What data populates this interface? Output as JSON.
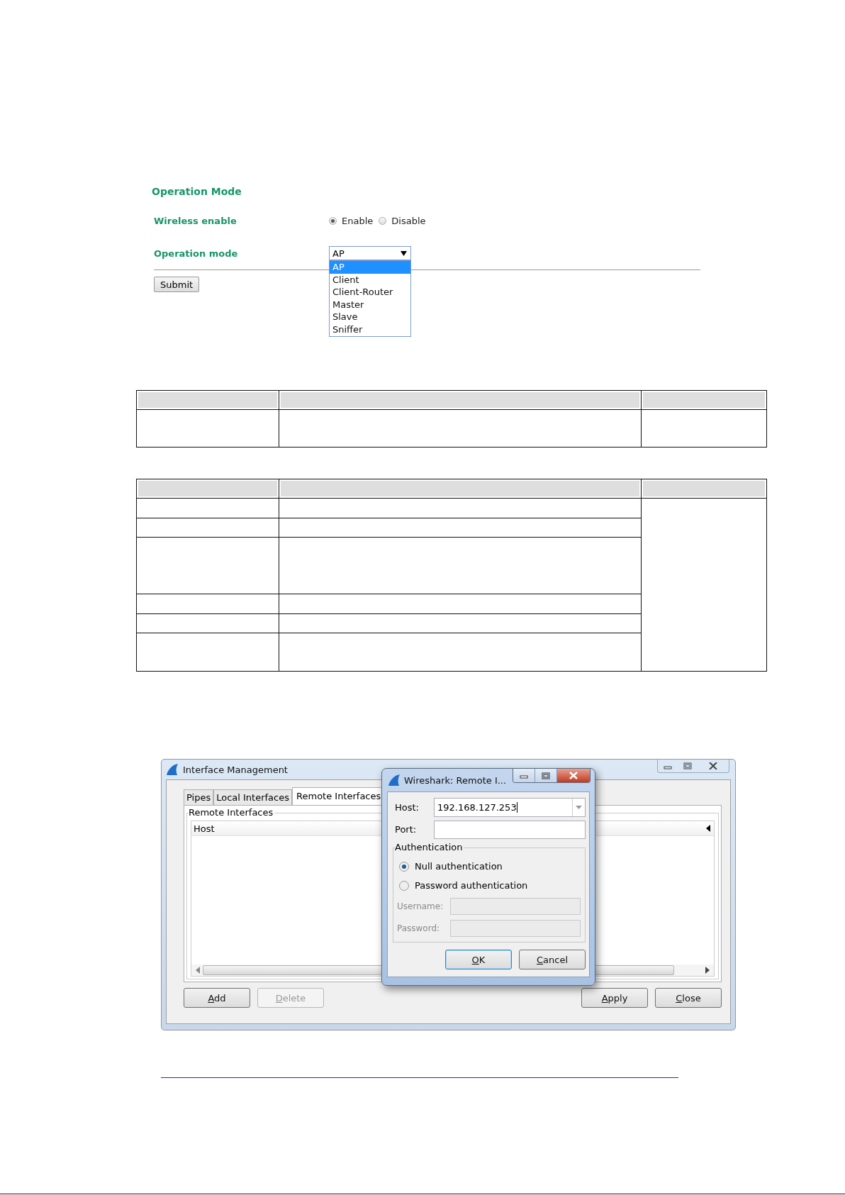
{
  "web_form": {
    "title": "Operation Mode",
    "fields": [
      {
        "kind": "radio",
        "label": "Wireless enable",
        "options": [
          {
            "label": "Enable",
            "selected": true
          },
          {
            "label": "Disable",
            "selected": false
          }
        ]
      },
      {
        "kind": "select",
        "label": "Operation mode",
        "value": "AP",
        "expanded": true,
        "options": [
          {
            "label": "AP",
            "selected": true
          },
          {
            "label": "Client",
            "selected": false
          },
          {
            "label": "Client-Router",
            "selected": false
          },
          {
            "label": "Master",
            "selected": false
          },
          {
            "label": "Slave",
            "selected": false
          },
          {
            "label": "Sniffer",
            "selected": false
          }
        ]
      }
    ],
    "submit": "Submit"
  },
  "interface_window": {
    "title": "Interface Management",
    "tabs": [
      {
        "label": "Pipes",
        "selected": false
      },
      {
        "label": "Local Interfaces",
        "selected": false
      },
      {
        "label": "Remote Interfaces",
        "selected": true
      }
    ],
    "group_title": "Remote Interfaces",
    "list_columns": [
      "Host"
    ],
    "left_buttons": [
      {
        "label": "Add",
        "disabled": false,
        "mnemonic": true
      },
      {
        "label": "Delete",
        "disabled": true,
        "mnemonic": true
      }
    ],
    "right_buttons": [
      {
        "label": "Apply",
        "disabled": false,
        "mnemonic": true
      },
      {
        "label": "Close",
        "disabled": false,
        "mnemonic": true
      }
    ]
  },
  "remote_dialog": {
    "title": "Wireshark: Remote I...",
    "host": {
      "label": "Host:",
      "value": "192.168.127.253"
    },
    "port": {
      "label": "Port:"
    },
    "auth_group": "Authentication",
    "auth_options": [
      {
        "label": "Null authentication",
        "selected": true
      },
      {
        "label": "Password authentication",
        "selected": false
      }
    ],
    "credentials": [
      {
        "label": "Username:",
        "disabled": true
      },
      {
        "label": "Password:",
        "disabled": true
      }
    ],
    "buttons": [
      {
        "label": "OK",
        "default": true,
        "mnemonic": true
      },
      {
        "label": "Cancel",
        "default": false,
        "mnemonic": true
      }
    ]
  }
}
